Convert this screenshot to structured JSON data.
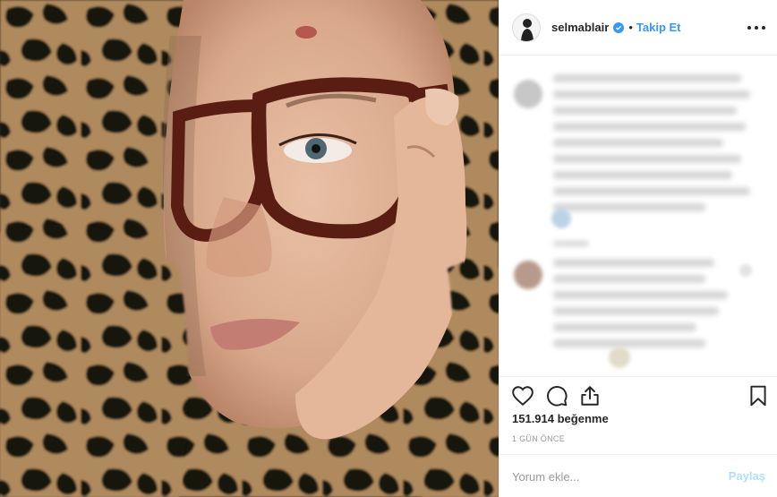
{
  "post": {
    "photo_alt": "",
    "header": {
      "username": "selmablair",
      "dot": "•",
      "follow_label": "Takip Et"
    },
    "actions": {
      "like_icon": "heart-icon",
      "comment_icon": "comment-icon",
      "share_icon": "share-icon",
      "save_icon": "bookmark-icon"
    },
    "likes_text": "151.914 beğenme",
    "timestamp": "1 GÜN ÖNCE",
    "comment_box": {
      "placeholder": "Yorum ekle...",
      "submit_label": "Paylaş"
    }
  },
  "colors": {
    "link_blue": "#3897f0",
    "share_disabled": "#b2dffc",
    "verified_blue": "#3897f0"
  }
}
